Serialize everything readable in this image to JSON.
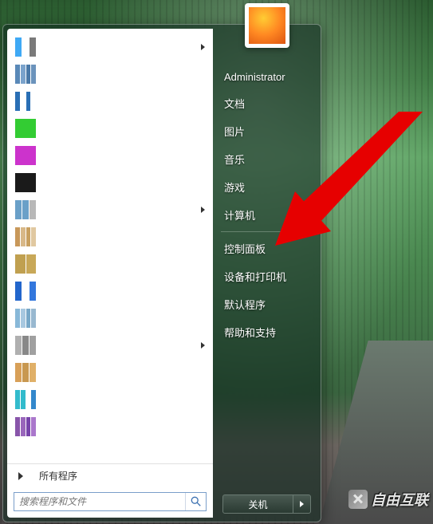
{
  "user_account": "Administrator",
  "right_menu": {
    "documents": "文档",
    "pictures": "图片",
    "music": "音乐",
    "games": "游戏",
    "computer": "计算机",
    "control_panel": "控制面板",
    "devices_printers": "设备和打印机",
    "default_programs": "默认程序",
    "help_support": "帮助和支持"
  },
  "all_programs_label": "所有程序",
  "search_placeholder": "搜索程序和文件",
  "shutdown_label": "关机",
  "watermark": "自由互联",
  "program_icons": [
    {
      "colors": [
        "#3fa9f5",
        "#ffffff",
        "#7a7a7a"
      ],
      "arrow": true
    },
    {
      "colors": [
        "#5a89b8",
        "#7ba3cc",
        "#4a79a8",
        "#6b93bc"
      ],
      "arrow": false
    },
    {
      "colors": [
        "#2a6fb5",
        "#ffffff",
        "#2a6fb5",
        "#ffffff"
      ],
      "arrow": false
    },
    {
      "colors": [
        "#33cc33"
      ],
      "arrow": false
    },
    {
      "colors": [
        "#cc33cc"
      ],
      "arrow": false
    },
    {
      "colors": [
        "#1a1a1a"
      ],
      "arrow": false
    },
    {
      "colors": [
        "#6aa0c8",
        "#6aa0c8",
        "#b8b8b8"
      ],
      "arrow": true
    },
    {
      "colors": [
        "#c8985a",
        "#d8b888",
        "#c8a060",
        "#e0c8a0"
      ],
      "arrow": false
    },
    {
      "colors": [
        "#c0a050",
        "#c8a858"
      ],
      "arrow": false
    },
    {
      "colors": [
        "#2266cc",
        "#ffffff",
        "#3377dd"
      ],
      "arrow": false
    },
    {
      "colors": [
        "#88b8d8",
        "#a8c8e0",
        "#78a8c8",
        "#98b8d0"
      ],
      "arrow": false
    },
    {
      "colors": [
        "#b0b0b0",
        "#888888",
        "#a0a0a0"
      ],
      "arrow": true
    },
    {
      "colors": [
        "#d8a058",
        "#c89850",
        "#e0b068"
      ],
      "arrow": false
    },
    {
      "colors": [
        "#33bbcc",
        "#33bbcc",
        "#ffffff",
        "#3388cc"
      ],
      "arrow": false
    },
    {
      "colors": [
        "#8855aa",
        "#9966bb",
        "#7744aa",
        "#aa77cc"
      ],
      "arrow": false
    }
  ]
}
